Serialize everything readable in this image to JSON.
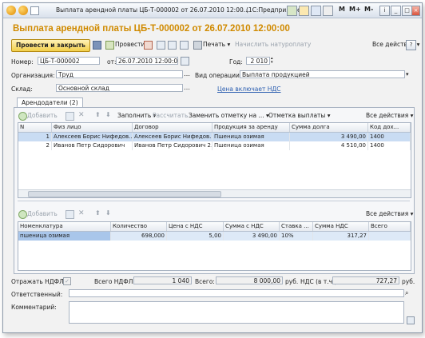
{
  "window": {
    "title": "Выплата арендной платы ЦБ-Т-000002 от 26.07.2010 12:00...",
    "app": "(1С:Предприятие)",
    "controls": [
      "M",
      "M+",
      "M-"
    ]
  },
  "doc_title": "Выплата арендной платы ЦБ-Т-000002 от 26.07.2010 12:00:00",
  "toolbar": {
    "post_close": "Провести и закрыть",
    "post": "Провести",
    "print": "Печать",
    "charge": "Начислить натуроплату",
    "all_actions": "Все действия"
  },
  "fields": {
    "number_label": "Номер:",
    "number": "ЦБ-Т-000002",
    "date_label": "от:",
    "date": "26.07.2010 12:00:00",
    "year_label": "Год:",
    "year": "2 010",
    "org_label": "Организация:",
    "org": "Труд",
    "op_label": "Вид операции:",
    "op": "Выплата продукцией",
    "warehouse_label": "Склад:",
    "warehouse": "Основной склад",
    "price_link": "Цена включает НДС"
  },
  "tab": {
    "label": "Арендодатели (2)"
  },
  "grid_toolbar": {
    "add": "Добавить",
    "fill": "Заполнить",
    "calc": "Рассчитать",
    "mark": "Заменить отметку на ...",
    "pay_mark": "Отметка выплаты",
    "all_actions": "Все действия"
  },
  "grid1": {
    "columns": [
      "N",
      "Физ лицо",
      "Договор",
      "Продукция за аренду",
      "Сумма долга",
      "Код дох..."
    ],
    "rows": [
      [
        "1",
        "Алексеев Борис Нифедов...",
        "Алексеев Борис Нифедов...",
        "Пшеница озимая",
        "3 490,00",
        "1400"
      ],
      [
        "2",
        "Иванов Петр Сидорович",
        "Иванов Петр Сидорович 2...",
        "Пшеница озимая",
        "4 510,00",
        "1400"
      ]
    ]
  },
  "grid2_toolbar": {
    "add": "Добавить",
    "all_actions": "Все действия"
  },
  "grid2": {
    "columns": [
      "Номенклатура",
      "Количество",
      "Цена с НДС",
      "Сумма с НДС",
      "Ставка ...",
      "Сумма НДС",
      "Всего"
    ],
    "rows": [
      [
        "пшеница озимая",
        "698,000",
        "5,00",
        "3 490,00",
        "10%",
        "317,27",
        ""
      ]
    ]
  },
  "footer": {
    "ndfl_label": "Отражать НДФЛ:",
    "total_ndfl_label": "Всего НДФЛ:",
    "total_ndfl": "1 040",
    "total_label": "Всего:",
    "total": "8 000,00",
    "currency": "руб.",
    "vat_label": "НДС (в т.ч.):",
    "vat": "727,27",
    "vat_currency": "руб.",
    "responsible_label": "Ответственный:",
    "comment_label": "Комментарий:"
  }
}
